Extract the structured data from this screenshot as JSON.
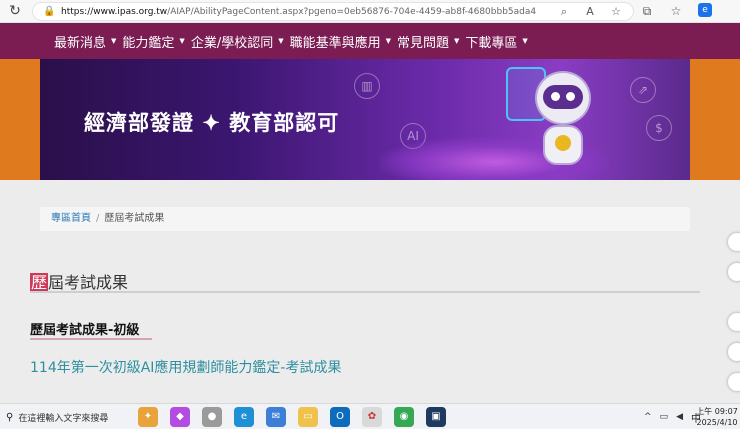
{
  "browser": {
    "url_host": "https://www.ipas.org.tw",
    "url_path": "/AIAP/AbilityPageContent.aspx?pgeno=0eb56876-704e-4459-ab8f-4680bbb5ada4",
    "icons": [
      "reload-icon",
      "lock-icon",
      "zoom-icon",
      "read-aloud-icon",
      "favorite-star-icon",
      "extensions-icon",
      "favorites-icon",
      "edge-sidebar-icon"
    ]
  },
  "nav": {
    "items": [
      {
        "label": "最新消息"
      },
      {
        "label": "能力鑑定"
      },
      {
        "label": "企業/學校認同"
      },
      {
        "label": "職能基準與應用"
      },
      {
        "label": "常見問題"
      },
      {
        "label": "下載專區"
      }
    ]
  },
  "banner": {
    "slogan": "經濟部發證 ✦ 教育部認可"
  },
  "breadcrumb": {
    "home": "專區首頁",
    "separator": "/",
    "current": "歷屆考試成果"
  },
  "page": {
    "title_first_char": "歷",
    "title_rest": "屆考試成果",
    "section_title": "歷屆考試成果-初級",
    "result_link": "114年第一次初級AI應用規劃師能力鑑定-考試成果"
  },
  "taskbar": {
    "search_placeholder": "在這裡輸入文字來搜尋",
    "ime": "中",
    "time": "上午 09:07",
    "date": "2025/4/10"
  },
  "colors": {
    "nav_bg": "#7b1d53",
    "banner_side": "#e07a1f",
    "link": "#2f8fa0",
    "title_highlight": "#d03a5a"
  }
}
